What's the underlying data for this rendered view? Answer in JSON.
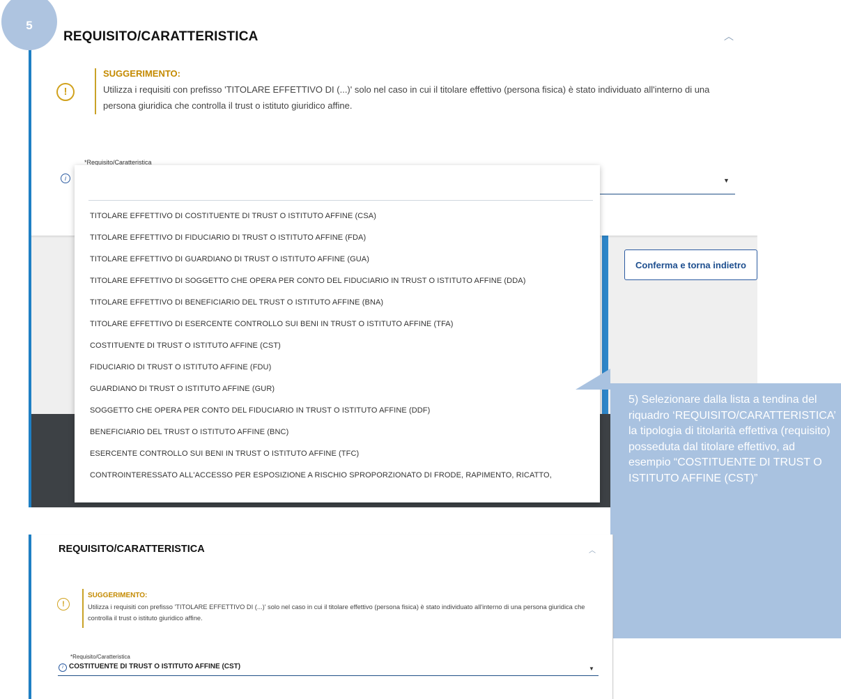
{
  "step": {
    "number": "5"
  },
  "top": {
    "title": "REQUISITO/CARATTERISTICA",
    "hint_title": "SUGGERIMENTO:",
    "hint_text": "Utilizza i requisiti con prefisso 'TITOLARE EFFETTIVO DI (...)' solo nel caso in cui il titolare effettivo (persona fisica) è stato individuato all'interno di una persona giuridica che controlla il trust o istituto giuridico affine.",
    "field_label": "*Requisito/Caratteristica",
    "confirm_button": "Conferma e torna indietro"
  },
  "dropdown": {
    "search_value": "",
    "options": [
      "TITOLARE EFFETTIVO DI COSTITUENTE DI TRUST O ISTITUTO AFFINE (CSA)",
      "TITOLARE EFFETTIVO DI FIDUCIARIO DI TRUST O ISTITUTO AFFINE (FDA)",
      "TITOLARE EFFETTIVO DI GUARDIANO DI TRUST O ISTITUTO AFFINE (GUA)",
      "TITOLARE EFFETTIVO DI SOGGETTO CHE OPERA PER CONTO DEL FIDUCIARIO IN TRUST O ISTITUTO AFFINE (DDA)",
      "TITOLARE EFFETTIVO DI BENEFICIARIO DEL TRUST O ISTITUTO AFFINE (BNA)",
      "TITOLARE EFFETTIVO DI ESERCENTE CONTROLLO SUI BENI IN TRUST O ISTITUTO AFFINE (TFA)",
      "COSTITUENTE DI TRUST O ISTITUTO AFFINE (CST)",
      "FIDUCIARIO DI TRUST O ISTITUTO AFFINE (FDU)",
      "GUARDIANO DI TRUST O ISTITUTO AFFINE (GUR)",
      "SOGGETTO CHE OPERA PER CONTO DEL FIDUCIARIO IN TRUST O ISTITUTO AFFINE (DDF)",
      "BENEFICIARIO DEL TRUST O ISTITUTO AFFINE (BNC)",
      "ESERCENTE CONTROLLO SUI BENI IN TRUST O ISTITUTO AFFINE (TFC)",
      "CONTROINTERESSATO ALL'ACCESSO PER ESPOSIZIONE A RISCHIO SPROPORZIONATO DI FRODE, RAPIMENTO, RICATTO,"
    ]
  },
  "callout": {
    "text": "5) Selezionare dalla lista a tendina del riquadro ‘REQUISITO/CARATTERISTICA’ la tipologia di titolarità effettiva (requisito) posseduta dal titolare effettivo, ad esempio “COSTITUENTE DI TRUST O ISTITUTO AFFINE (CST)”"
  },
  "bottom": {
    "title": "REQUISITO/CARATTERISTICA",
    "hint_title": "SUGGERIMENTO:",
    "hint_text": "Utilizza i requisiti con prefisso 'TITOLARE EFFETTIVO DI (...)' solo nel caso in cui il titolare effettivo (persona fisica) è stato individuato all'interno di una persona giuridica che controlla il trust o istituto giuridico affine.",
    "field_label": "*Requisito/Caratteristica",
    "selected_value": "COSTITUENTE DI TRUST O ISTITUTO AFFINE (CST)"
  },
  "colors": {
    "accent_blue": "#1e7fc4",
    "hint_gold": "#c48a00",
    "callout_blue": "#a9c2e0"
  }
}
